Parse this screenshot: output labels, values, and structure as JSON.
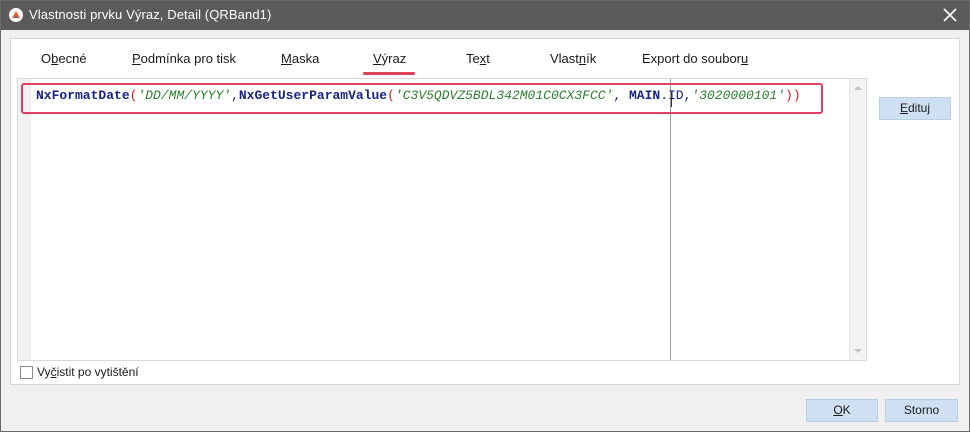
{
  "window": {
    "title": "Vlastnosti prvku Výraz, Detail (QRBand1)"
  },
  "tabs": [
    {
      "label_pre": "O",
      "label_u": "b",
      "label_post": "ecné"
    },
    {
      "label_pre": "",
      "label_u": "P",
      "label_post": "odmínka pro tisk"
    },
    {
      "label_pre": "",
      "label_u": "M",
      "label_post": "aska"
    },
    {
      "label_pre": "",
      "label_u": "V",
      "label_post": "ýraz"
    },
    {
      "label_pre": "Te",
      "label_u": "x",
      "label_post": "t"
    },
    {
      "label_pre": "Vlast",
      "label_u": "n",
      "label_post": "ík"
    },
    {
      "label_pre": "Export do soubor",
      "label_u": "u",
      "label_post": ""
    }
  ],
  "active_tab": "Výraz",
  "expression": {
    "fn1": "NxFormatDate",
    "open1": "(",
    "str1": "'DD/MM/YYYY'",
    "comma1": ",",
    "fn2": "NxGetUserParamValue",
    "open2": "(",
    "str2": "'C3V5QDVZ5BDL342M01C0CX3FCC'",
    "comma2": ", ",
    "field_a": "MAIN",
    "field_b": ".ID,",
    "str3": "'3020000101'",
    "close": "))"
  },
  "buttons": {
    "edit_u": "E",
    "edit_rest": "dituj",
    "ok_u": "O",
    "ok_rest": "K",
    "cancel": "Storno"
  },
  "checkbox": {
    "label_pre": "Vy",
    "label_u": "č",
    "label_post": "istit po vytištění",
    "checked": false
  },
  "colors": {
    "titlebar": "#5b5b5b",
    "tab_accent": "#e0445c",
    "highlight_border": "#e24063",
    "button_bg": "#cfe0f2",
    "string_color": "#2e7d32",
    "function_color": "#1a237e",
    "paren_color": "#d81b1b"
  }
}
